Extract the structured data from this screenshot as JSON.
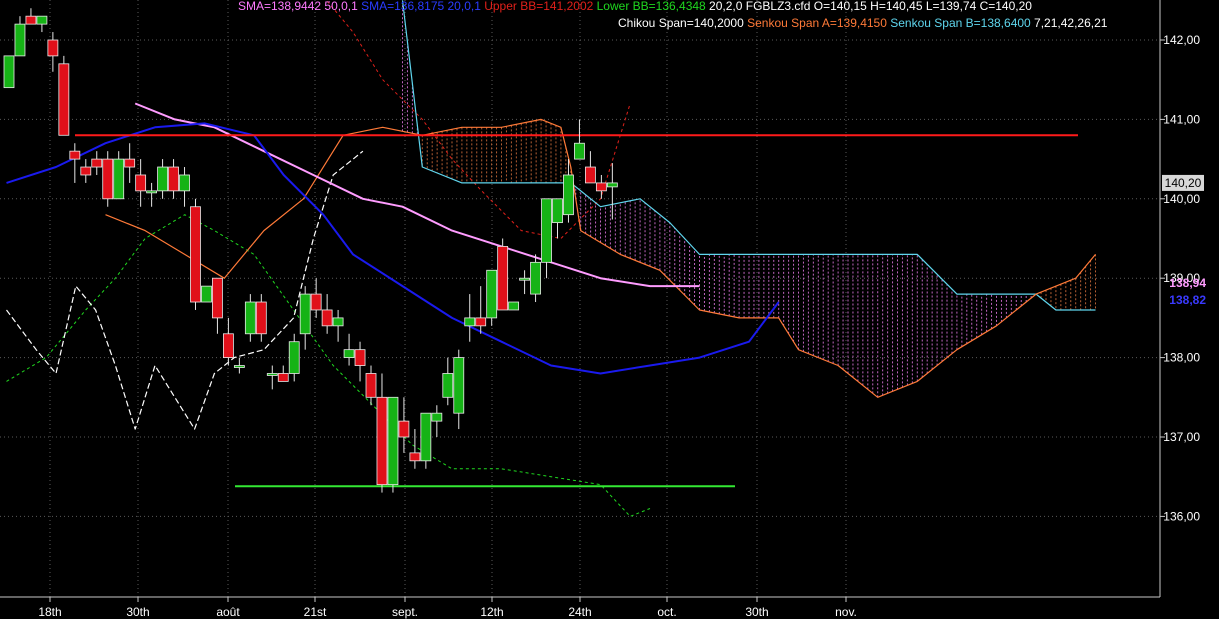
{
  "header": {
    "line1": [
      {
        "text": "SMA=138,9442",
        "color": "#ff7bff"
      },
      {
        "text": " 50,0,1",
        "color": "#ff7bff"
      },
      {
        "text": "     SMA=136,8175",
        "color": "#2a3cff"
      },
      {
        "text": " 20,0,1",
        "color": "#2a3cff"
      },
      {
        "text": "      Upper BB=141,2002",
        "color": "#e0201a"
      },
      {
        "text": "  Lower BB=136,4348",
        "color": "#1fd81f"
      },
      {
        "text": "  20,2,0",
        "color": "#ffffff"
      },
      {
        "text": "     FGBLZ3.cfd O=140,15 H=140,45 L=139,74 C=140,20",
        "color": "#ffffff"
      }
    ],
    "line2": [
      {
        "text": "Chikou Span=140,2000",
        "color": "#ffffff"
      },
      {
        "text": " Senkou Span A=139,4150",
        "color": "#ff7a38"
      },
      {
        "text": " Senkou Span B=138,6400",
        "color": "#5fd6ee"
      },
      {
        "text": "  7,21,42,26,21",
        "color": "#ffffff"
      }
    ]
  },
  "colors": {
    "up": "#16b316",
    "down": "#e0101a",
    "sma50": "#ff9cff",
    "sma20": "#1a1aee",
    "senkouA": "#ff7a38",
    "senkouB": "#5fd6ee",
    "chikou": "#ffffff",
    "lowerBB": "#1fd81f",
    "upperBB": "#e0201a",
    "resistance": "#ff1a1a",
    "support": "#33e833",
    "grid": "#5a5a5a",
    "axis": "#ffffff"
  },
  "chart_data": {
    "type": "candlestick",
    "title": "FGBLZ3.cfd",
    "ylim": [
      135,
      143
    ],
    "y_ticks": [
      "136,00",
      "137,00",
      "138,00",
      "139,00",
      "140,00",
      "141,00",
      "142,00"
    ],
    "x_ticks": [
      "18th",
      "30th",
      "août",
      "21st",
      "sept.",
      "12th",
      "24th",
      "oct.",
      "30th",
      "nov."
    ],
    "last_price": "140,20",
    "sma50_label": "138,94",
    "sma20_label": "138,82",
    "candles": [
      [
        141.4,
        141.8,
        141.4,
        141.8
      ],
      [
        141.8,
        142.3,
        141.8,
        142.2
      ],
      [
        142.3,
        142.4,
        142.2,
        142.2
      ],
      [
        142.2,
        142.3,
        142.1,
        142.3
      ],
      [
        142.0,
        142.1,
        141.6,
        141.8
      ],
      [
        141.7,
        141.8,
        140.8,
        140.8
      ],
      [
        140.6,
        140.7,
        140.2,
        140.5
      ],
      [
        140.4,
        140.5,
        140.2,
        140.3
      ],
      [
        140.5,
        140.6,
        140.3,
        140.4
      ],
      [
        140.5,
        140.6,
        139.9,
        140.0
      ],
      [
        140.0,
        140.6,
        140.0,
        140.5
      ],
      [
        140.5,
        140.7,
        140.2,
        140.4
      ],
      [
        140.3,
        140.5,
        139.9,
        140.1
      ],
      [
        140.1,
        140.2,
        139.9,
        140.1
      ],
      [
        140.1,
        140.5,
        140.0,
        140.4
      ],
      [
        140.4,
        140.5,
        140.0,
        140.1
      ],
      [
        140.1,
        140.4,
        139.9,
        140.3
      ],
      [
        139.9,
        140.0,
        138.6,
        138.7
      ],
      [
        138.7,
        138.9,
        138.7,
        138.9
      ],
      [
        139.0,
        139.0,
        138.3,
        138.5
      ],
      [
        138.3,
        138.5,
        137.9,
        138.0
      ],
      [
        137.9,
        138.0,
        137.8,
        137.9
      ],
      [
        138.3,
        138.8,
        138.2,
        138.7
      ],
      [
        138.7,
        138.8,
        138.2,
        138.3
      ],
      [
        137.8,
        137.9,
        137.6,
        137.8
      ],
      [
        137.8,
        137.9,
        137.7,
        137.7
      ],
      [
        137.8,
        138.3,
        137.7,
        138.2
      ],
      [
        138.3,
        138.9,
        138.1,
        138.8
      ],
      [
        138.8,
        139.0,
        138.5,
        138.6
      ],
      [
        138.6,
        138.8,
        138.3,
        138.4
      ],
      [
        138.4,
        138.6,
        138.2,
        138.5
      ],
      [
        138.0,
        138.3,
        137.9,
        138.1
      ],
      [
        138.1,
        138.2,
        137.7,
        137.9
      ],
      [
        137.8,
        137.9,
        137.4,
        137.5
      ],
      [
        137.5,
        137.8,
        136.3,
        136.4
      ],
      [
        136.4,
        137.5,
        136.3,
        137.5
      ],
      [
        137.2,
        137.5,
        136.8,
        137.0
      ],
      [
        136.8,
        137.1,
        136.6,
        136.7
      ],
      [
        136.7,
        137.3,
        136.6,
        137.3
      ],
      [
        137.2,
        137.4,
        137.0,
        137.3
      ],
      [
        137.5,
        138.0,
        137.4,
        137.8
      ],
      [
        137.3,
        138.1,
        137.1,
        138.0
      ],
      [
        138.4,
        138.8,
        138.2,
        138.5
      ],
      [
        138.5,
        138.9,
        138.3,
        138.4
      ],
      [
        138.5,
        139.1,
        138.4,
        139.1
      ],
      [
        139.4,
        139.5,
        138.6,
        138.6
      ],
      [
        138.6,
        138.7,
        138.6,
        138.7
      ],
      [
        139.0,
        139.1,
        138.8,
        139.0
      ],
      [
        138.8,
        139.3,
        138.7,
        139.2
      ],
      [
        139.2,
        140.0,
        139.0,
        140.0
      ],
      [
        139.7,
        140.0,
        139.5,
        140.0
      ],
      [
        139.8,
        140.5,
        139.7,
        140.3
      ],
      [
        140.5,
        141.0,
        140.5,
        140.7
      ],
      [
        140.4,
        140.6,
        140.2,
        140.2
      ],
      [
        140.2,
        140.3,
        140.0,
        140.1
      ],
      [
        140.15,
        140.45,
        139.74,
        140.2
      ]
    ],
    "sma20": [
      [
        0,
        140.2
      ],
      [
        5,
        140.4
      ],
      [
        10,
        140.7
      ],
      [
        15,
        140.9
      ],
      [
        20,
        140.95
      ],
      [
        25,
        140.8
      ],
      [
        28,
        140.3
      ],
      [
        32,
        139.8
      ],
      [
        35,
        139.3
      ],
      [
        40,
        138.9
      ],
      [
        45,
        138.5
      ],
      [
        50,
        138.2
      ],
      [
        55,
        137.9
      ],
      [
        60,
        137.8
      ],
      [
        65,
        137.9
      ],
      [
        70,
        138.0
      ],
      [
        75,
        138.2
      ],
      [
        78,
        138.7
      ]
    ],
    "sma50": [
      [
        13,
        141.2
      ],
      [
        17,
        141.0
      ],
      [
        21,
        140.9
      ],
      [
        26,
        140.6
      ],
      [
        31,
        140.3
      ],
      [
        36,
        140.0
      ],
      [
        40,
        139.9
      ],
      [
        45,
        139.6
      ],
      [
        50,
        139.4
      ],
      [
        55,
        139.2
      ],
      [
        60,
        139.0
      ],
      [
        65,
        138.9
      ],
      [
        70,
        138.9
      ]
    ],
    "senkouA": [
      [
        10,
        139.8
      ],
      [
        14,
        139.6
      ],
      [
        18,
        139.3
      ],
      [
        22,
        139.0
      ],
      [
        26,
        139.6
      ],
      [
        30,
        140.0
      ],
      [
        34,
        140.8
      ],
      [
        38,
        140.9
      ],
      [
        42,
        140.8
      ],
      [
        46,
        140.9
      ],
      [
        50,
        140.9
      ],
      [
        54,
        141.0
      ],
      [
        56,
        140.9
      ],
      [
        57,
        140.4
      ],
      [
        58,
        139.6
      ],
      [
        62,
        139.3
      ],
      [
        66,
        139.1
      ],
      [
        70,
        138.6
      ],
      [
        74,
        138.5
      ],
      [
        78,
        138.5
      ],
      [
        80,
        138.1
      ],
      [
        84,
        137.9
      ],
      [
        88,
        137.5
      ],
      [
        92,
        137.7
      ],
      [
        96,
        138.1
      ],
      [
        100,
        138.4
      ],
      [
        104,
        138.8
      ],
      [
        108,
        139.0
      ],
      [
        110,
        139.3
      ]
    ],
    "senkouB": [
      [
        40,
        142.5
      ],
      [
        42,
        140.4
      ],
      [
        46,
        140.2
      ],
      [
        52,
        140.2
      ],
      [
        57,
        140.2
      ],
      [
        60,
        139.9
      ],
      [
        64,
        140.0
      ],
      [
        67,
        139.7
      ],
      [
        70,
        139.3
      ],
      [
        74,
        139.3
      ],
      [
        80,
        139.3
      ],
      [
        92,
        139.3
      ],
      [
        96,
        138.8
      ],
      [
        100,
        138.8
      ],
      [
        104,
        138.8
      ],
      [
        106,
        138.6
      ],
      [
        110,
        138.6
      ]
    ],
    "chikou": [
      [
        0,
        138.6
      ],
      [
        3,
        138.1
      ],
      [
        5,
        137.8
      ],
      [
        7,
        138.9
      ],
      [
        9,
        138.6
      ],
      [
        11,
        137.9
      ],
      [
        13,
        137.1
      ],
      [
        15,
        137.9
      ],
      [
        17,
        137.5
      ],
      [
        19,
        137.1
      ],
      [
        21,
        137.8
      ],
      [
        23,
        138.0
      ],
      [
        26,
        138.1
      ],
      [
        29,
        138.5
      ],
      [
        31,
        139.5
      ],
      [
        33,
        140.3
      ],
      [
        36,
        140.6
      ]
    ],
    "lowerBB": [
      [
        0,
        137.7
      ],
      [
        4,
        138.0
      ],
      [
        8,
        138.6
      ],
      [
        11,
        139.0
      ],
      [
        14,
        139.5
      ],
      [
        18,
        139.8
      ],
      [
        21,
        139.6
      ],
      [
        25,
        139.3
      ],
      [
        29,
        138.6
      ],
      [
        33,
        137.9
      ],
      [
        37,
        137.4
      ],
      [
        41,
        136.9
      ],
      [
        45,
        136.6
      ],
      [
        50,
        136.6
      ],
      [
        55,
        136.5
      ],
      [
        60,
        136.4
      ],
      [
        63,
        136.0
      ],
      [
        65,
        136.1
      ]
    ],
    "upperBB": [
      [
        27,
        143.2
      ],
      [
        31,
        142.7
      ],
      [
        35,
        142.1
      ],
      [
        38,
        141.5
      ],
      [
        42,
        141.0
      ],
      [
        45,
        140.5
      ],
      [
        48,
        140.1
      ],
      [
        52,
        139.6
      ],
      [
        56,
        139.5
      ],
      [
        60,
        140.0
      ],
      [
        63,
        141.2
      ]
    ],
    "resistance": {
      "y": 140.8,
      "x0": 5,
      "x1": 97
    },
    "support": {
      "y": 136.38,
      "x0": 16,
      "x1": 62
    }
  }
}
